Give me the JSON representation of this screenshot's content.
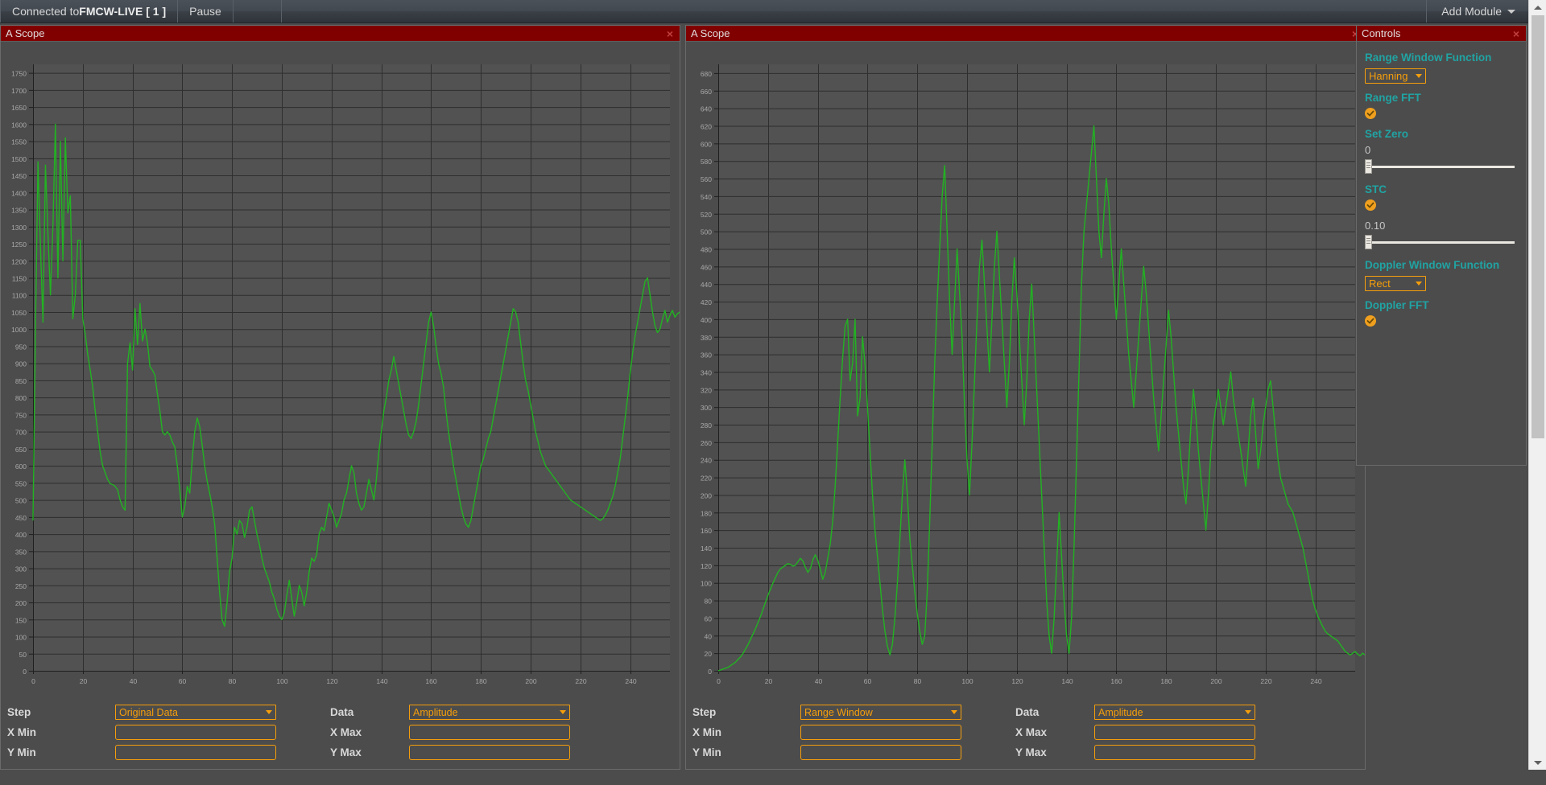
{
  "menubar": {
    "connection_prefix": "Connected to ",
    "connection_target": "FMCW-LIVE [ 1 ]",
    "pause_label": "Pause",
    "add_module_label": "Add Module"
  },
  "colors": {
    "title_bar_red": "#800000",
    "panel_bg": "#4c4c4c",
    "accent_orange": "#f59e0b",
    "accent_teal": "#21a3a3",
    "trace_green": "#22b222",
    "menubar_bg": "#3a4046"
  },
  "scope_a": {
    "title": "A Scope",
    "close_label": "×",
    "form": {
      "step_label": "Step",
      "step_value": "Original Data",
      "data_label": "Data",
      "data_value": "Amplitude",
      "xmin_label": "X Min",
      "xmin_value": "",
      "xmax_label": "X Max",
      "xmax_value": "",
      "ymin_label": "Y Min",
      "ymin_value": "",
      "ymax_label": "Y Max",
      "ymax_value": ""
    }
  },
  "scope_b": {
    "title": "A Scope",
    "close_label": "×",
    "form": {
      "step_label": "Step",
      "step_value": "Range Window",
      "data_label": "Data",
      "data_value": "Amplitude",
      "xmin_label": "X Min",
      "xmin_value": "",
      "xmax_label": "X Max",
      "xmax_value": "",
      "ymin_label": "Y Min",
      "ymin_value": "",
      "ymax_label": "Y Max",
      "ymax_value": ""
    }
  },
  "controls": {
    "title": "Controls",
    "close_label": "×",
    "range_window_function_label": "Range Window Function",
    "range_window_function_value": "Hanning",
    "range_fft_label": "Range FFT",
    "range_fft_checked": true,
    "set_zero_label": "Set Zero",
    "set_zero_value": "0",
    "set_zero_slider_pct": 0,
    "stc_label": "STC",
    "stc_checked": true,
    "stc_value": "0.10",
    "stc_slider_pct": 0,
    "doppler_window_function_label": "Doppler Window Function",
    "doppler_window_function_value": "Rect",
    "doppler_fft_label": "Doppler FFT",
    "doppler_fft_checked": true
  },
  "scrollbar": {
    "up_icon": "triangle-up-icon",
    "down_icon": "triangle-down-icon",
    "thumb_top_pct": 2,
    "thumb_height_pct": 55
  },
  "chart_data": [
    {
      "id": "scope-a-plot",
      "type": "line",
      "title": "",
      "xlabel": "",
      "ylabel": "",
      "xlim": [
        0,
        256
      ],
      "ylim": [
        0,
        1775
      ],
      "grid": true,
      "legend": "none",
      "series_color": "#22b222",
      "xticks": [
        0,
        20,
        40,
        60,
        80,
        100,
        120,
        140,
        160,
        180,
        200,
        220,
        240
      ],
      "yticks": [
        0,
        50,
        100,
        150,
        200,
        250,
        300,
        350,
        400,
        450,
        500,
        550,
        600,
        650,
        700,
        750,
        800,
        850,
        900,
        950,
        1000,
        1050,
        1100,
        1150,
        1200,
        1250,
        1300,
        1350,
        1400,
        1450,
        1500,
        1550,
        1600,
        1650,
        1700,
        1750
      ],
      "series": [
        {
          "name": "Original Data",
          "values": [
            440,
            1010,
            1490,
            1240,
            1020,
            1480,
            1280,
            1100,
            1300,
            1600,
            1150,
            1550,
            1200,
            1560,
            1340,
            1390,
            1030,
            1100,
            1260,
            1260,
            1030,
            985,
            925,
            880,
            830,
            760,
            700,
            640,
            600,
            580,
            560,
            548,
            545,
            540,
            530,
            500,
            480,
            470,
            900,
            960,
            880,
            1060,
            955,
            1075,
            965,
            1000,
            960,
            890,
            880,
            865,
            810,
            760,
            700,
            690,
            700,
            690,
            670,
            655,
            600,
            530,
            450,
            480,
            540,
            520,
            620,
            700,
            740,
            715,
            660,
            600,
            555,
            520,
            480,
            430,
            330,
            230,
            150,
            130,
            200,
            290,
            330,
            420,
            400,
            440,
            430,
            390,
            420,
            470,
            480,
            440,
            400,
            370,
            330,
            300,
            280,
            260,
            230,
            210,
            180,
            160,
            150,
            170,
            220,
            265,
            210,
            160,
            200,
            250,
            230,
            190,
            230,
            290,
            330,
            320,
            340,
            400,
            420,
            410,
            450,
            490,
            470,
            450,
            420,
            440,
            460,
            500,
            520,
            560,
            600,
            580,
            520,
            490,
            470,
            480,
            520,
            560,
            530,
            500,
            560,
            640,
            700,
            760,
            800,
            850,
            880,
            920,
            880,
            840,
            800,
            760,
            720,
            690,
            680,
            700,
            730,
            780,
            840,
            900,
            960,
            1020,
            1050,
            1010,
            950,
            900,
            870,
            830,
            760,
            700,
            650,
            600,
            560,
            520,
            480,
            450,
            430,
            420,
            440,
            480,
            520,
            560,
            600,
            620,
            650,
            680,
            700,
            740,
            780,
            820,
            860,
            900,
            940,
            980,
            1020,
            1060,
            1050,
            1020,
            960,
            900,
            850,
            820,
            780,
            740,
            700,
            670,
            640,
            620,
            600,
            590,
            580,
            570,
            560,
            550,
            540,
            530,
            520,
            510,
            500,
            495,
            490,
            485,
            480,
            475,
            470,
            465,
            460,
            455,
            450,
            445,
            440,
            445,
            455,
            470,
            490,
            510,
            540,
            580,
            620,
            680,
            740,
            800,
            870,
            930,
            980,
            1020,
            1060,
            1100,
            1140,
            1150,
            1100,
            1050,
            1010,
            990,
            1000,
            1030,
            1055,
            1020,
            1040,
            1055,
            1035,
            1045,
            1050,
            1030,
            1040,
            1035
          ]
        }
      ]
    },
    {
      "id": "scope-b-plot",
      "type": "line",
      "title": "",
      "xlabel": "",
      "ylabel": "",
      "xlim": [
        0,
        256
      ],
      "ylim": [
        0,
        690
      ],
      "grid": true,
      "legend": "none",
      "series_color": "#22b222",
      "xticks": [
        0,
        20,
        40,
        60,
        80,
        100,
        120,
        140,
        160,
        180,
        200,
        220,
        240
      ],
      "yticks": [
        0,
        20,
        40,
        60,
        80,
        100,
        120,
        140,
        160,
        180,
        200,
        220,
        240,
        260,
        280,
        300,
        320,
        340,
        360,
        380,
        400,
        420,
        440,
        460,
        480,
        500,
        520,
        540,
        560,
        580,
        600,
        620,
        640,
        660,
        680
      ],
      "series": [
        {
          "name": "Range Window",
          "values": [
            0,
            1,
            2,
            3,
            4,
            6,
            8,
            10,
            13,
            16,
            20,
            25,
            30,
            36,
            42,
            48,
            55,
            62,
            70,
            78,
            86,
            93,
            100,
            106,
            112,
            116,
            118,
            120,
            122,
            121,
            119,
            120,
            124,
            128,
            125,
            118,
            112,
            116,
            126,
            132,
            126,
            116,
            104,
            112,
            128,
            144,
            170,
            210,
            260,
            310,
            356,
            392,
            400,
            330,
            350,
            400,
            290,
            310,
            380,
            348,
            300,
            250,
            200,
            160,
            130,
            100,
            70,
            45,
            28,
            18,
            30,
            60,
            100,
            150,
            200,
            240,
            200,
            150,
            120,
            90,
            65,
            45,
            30,
            40,
            90,
            170,
            260,
            350,
            420,
            480,
            540,
            575,
            500,
            420,
            360,
            420,
            480,
            430,
            380,
            300,
            240,
            200,
            260,
            330,
            400,
            460,
            490,
            440,
            390,
            340,
            400,
            460,
            500,
            450,
            400,
            350,
            300,
            350,
            420,
            470,
            430,
            380,
            330,
            280,
            330,
            400,
            440,
            380,
            320,
            260,
            200,
            140,
            80,
            40,
            20,
            60,
            120,
            180,
            130,
            80,
            40,
            20,
            60,
            140,
            240,
            340,
            440,
            500,
            530,
            560,
            590,
            620,
            560,
            500,
            470,
            520,
            560,
            530,
            480,
            440,
            400,
            440,
            480,
            440,
            400,
            360,
            330,
            300,
            340,
            380,
            420,
            460,
            430,
            390,
            350,
            310,
            280,
            250,
            290,
            330,
            370,
            410,
            380,
            340,
            300,
            270,
            240,
            210,
            190,
            230,
            280,
            320,
            290,
            250,
            220,
            190,
            160,
            200,
            250,
            280,
            300,
            320,
            300,
            280,
            300,
            320,
            340,
            310,
            290,
            270,
            250,
            230,
            210,
            250,
            290,
            310,
            270,
            230,
            250,
            280,
            300,
            320,
            330,
            300,
            270,
            240,
            220,
            210,
            200,
            190,
            185,
            180,
            170,
            160,
            150,
            140,
            125,
            110,
            95,
            80,
            70,
            62,
            56,
            50,
            45,
            42,
            40,
            38,
            36,
            34,
            30,
            26,
            22,
            20,
            18,
            20,
            22,
            19,
            17,
            20,
            18,
            14,
            10,
            7,
            4,
            2
          ]
        }
      ]
    }
  ]
}
